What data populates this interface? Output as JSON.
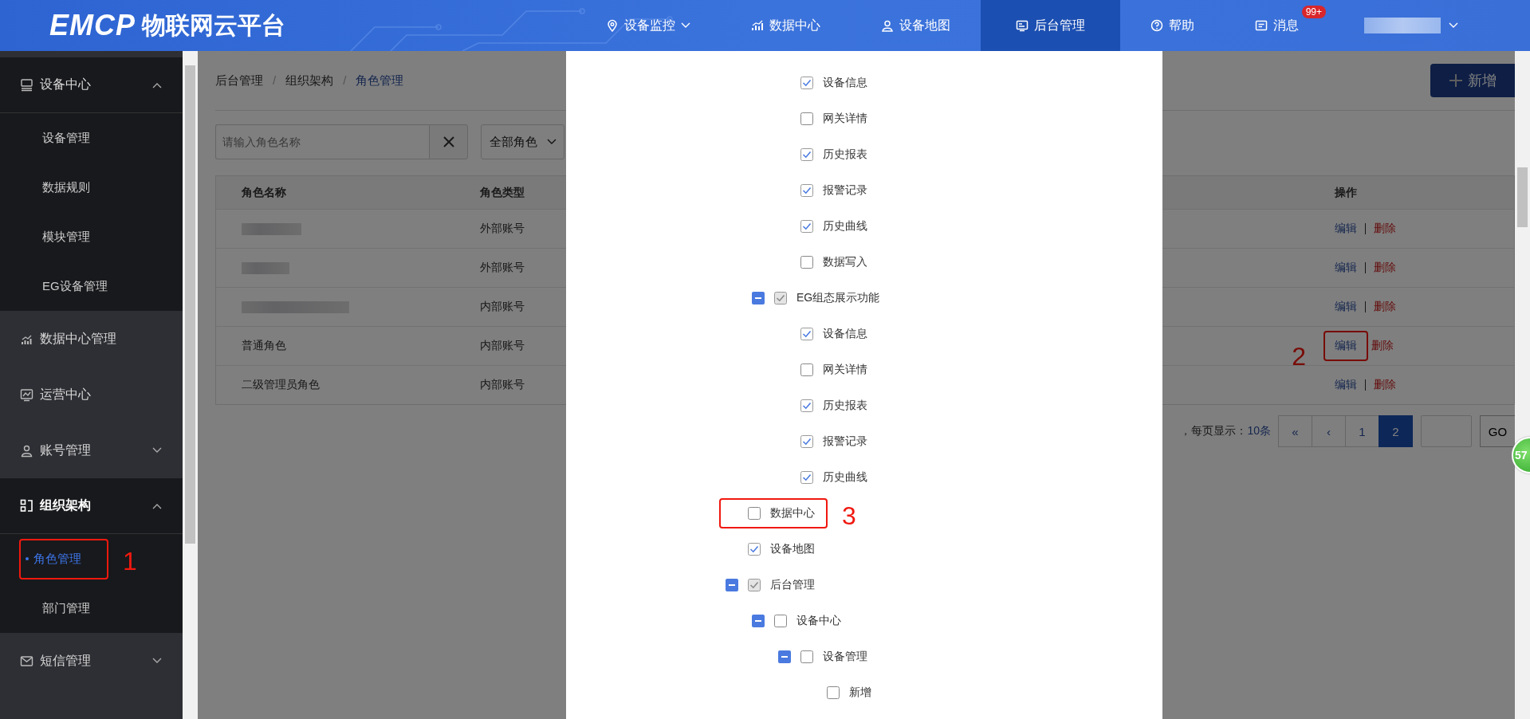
{
  "header": {
    "logo": "EMCP",
    "title": "物联网云平台",
    "nav": [
      {
        "label": "设备监控",
        "selected": false,
        "caret": true
      },
      {
        "label": "数据中心",
        "selected": false,
        "caret": false
      },
      {
        "label": "设备地图",
        "selected": false,
        "caret": false
      },
      {
        "label": "后台管理",
        "selected": true,
        "caret": false
      },
      {
        "label": "帮助",
        "selected": false,
        "caret": false
      },
      {
        "label": "消息",
        "selected": false,
        "caret": false,
        "badge": "99+"
      }
    ],
    "user": {
      "redacted": true
    }
  },
  "sidebar": {
    "items": [
      {
        "label": "设备中心",
        "expanded": true,
        "selected": false,
        "children": [
          {
            "label": "设备管理",
            "selected": false
          },
          {
            "label": "数据规则",
            "selected": false
          },
          {
            "label": "模块管理",
            "selected": false
          },
          {
            "label": "EG设备管理",
            "selected": false
          }
        ]
      },
      {
        "label": "数据中心管理",
        "expanded": false,
        "selected": false
      },
      {
        "label": "运营中心",
        "expanded": false,
        "selected": false
      },
      {
        "label": "账号管理",
        "expanded": false,
        "selected": false,
        "caret": true
      },
      {
        "label": "组织架构",
        "expanded": true,
        "selected": true,
        "children": [
          {
            "label": "角色管理",
            "selected": true,
            "callout": {
              "number": "1"
            }
          },
          {
            "label": "部门管理",
            "selected": false
          }
        ]
      },
      {
        "label": "短信管理",
        "expanded": false,
        "selected": false,
        "caret": true
      }
    ]
  },
  "breadcrumb": {
    "separator": "/",
    "items": [
      "后台管理",
      "组织架构",
      "角色管理"
    ]
  },
  "new_button": "新增",
  "search": {
    "placeholder": "请输入角色名称"
  },
  "role_filter": "全部角色",
  "table": {
    "columns": [
      "角色名称",
      "角色类型",
      "操作"
    ],
    "rows": [
      {
        "redacted": true,
        "type": "外部账号",
        "actions": [
          "编辑",
          "删除"
        ]
      },
      {
        "redacted": true,
        "type": "外部账号",
        "actions": [
          "编辑",
          "删除"
        ]
      },
      {
        "redacted": true,
        "type": "内部账号",
        "actions": [
          "编辑",
          "删除"
        ]
      },
      {
        "redacted": false,
        "name": "普通角色",
        "type": "内部账号",
        "actions": [
          "编辑",
          "删除"
        ],
        "callout": {
          "number": "2"
        }
      },
      {
        "redacted": false,
        "name": "二级管理员角色",
        "type": "内部账号",
        "actions": [
          "编辑",
          "删除"
        ]
      }
    ]
  },
  "pagination": {
    "summary": "，每页显示：",
    "page_size": "10条",
    "pages": [
      {
        "label": "«",
        "selected": false
      },
      {
        "label": "‹",
        "selected": false
      },
      {
        "label": "1",
        "selected": false
      },
      {
        "label": "2",
        "selected": true
      }
    ],
    "go": "GO"
  },
  "permission_tree": [
    {
      "children": [
        {
          "children": [
            {
              "label": "设备信息",
              "checked": true,
              "indeterminate": false
            },
            {
              "label": "网关详情",
              "checked": false,
              "indeterminate": false
            },
            {
              "label": "历史报表",
              "checked": true,
              "indeterminate": false
            },
            {
              "label": "报警记录",
              "checked": true,
              "indeterminate": false
            },
            {
              "label": "历史曲线",
              "checked": true,
              "indeterminate": false
            },
            {
              "label": "数据写入",
              "checked": false,
              "indeterminate": false
            }
          ]
        },
        {
          "label": "EG组态展示功能",
          "checked": true,
          "indeterminate": true,
          "expanded": true,
          "children": [
            {
              "label": "设备信息",
              "checked": true,
              "indeterminate": false
            },
            {
              "label": "网关详情",
              "checked": false,
              "indeterminate": false
            },
            {
              "label": "历史报表",
              "checked": true,
              "indeterminate": false
            },
            {
              "label": "报警记录",
              "checked": true,
              "indeterminate": false
            },
            {
              "label": "历史曲线",
              "checked": true,
              "indeterminate": false
            }
          ]
        }
      ]
    },
    {
      "label": "数据中心",
      "checked": false,
      "indeterminate": false,
      "callout": {
        "number": "3"
      }
    },
    {
      "label": "设备地图",
      "checked": true,
      "indeterminate": false
    },
    {
      "label": "后台管理",
      "checked": true,
      "indeterminate": true,
      "expanded": true,
      "children": [
        {
          "label": "设备中心",
          "checked": false,
          "indeterminate": false,
          "expanded": true,
          "children": [
            {
              "label": "设备管理",
              "checked": false,
              "indeterminate": false,
              "expanded": true,
              "children": [
                {
                  "label": "新增",
                  "checked": false,
                  "indeterminate": false
                }
              ]
            }
          ]
        }
      ]
    }
  ],
  "float_badge": "57"
}
